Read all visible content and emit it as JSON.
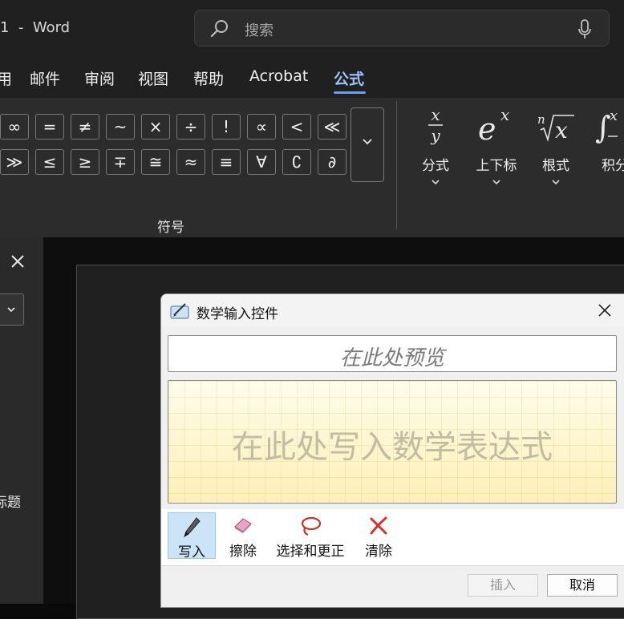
{
  "app": {
    "window_title": "1  -  Word"
  },
  "search": {
    "placeholder": "搜索"
  },
  "menu": [
    {
      "label": "用"
    },
    {
      "label": "邮件"
    },
    {
      "label": "审阅"
    },
    {
      "label": "视图"
    },
    {
      "label": "帮助"
    },
    {
      "label": "Acrobat"
    },
    {
      "label": "公式"
    }
  ],
  "symbols": {
    "row1": [
      "∞",
      "=",
      "≠",
      "~",
      "×",
      "÷",
      "!",
      "∝",
      "<",
      "≪"
    ],
    "row2": [
      "≫",
      "≤",
      "≥",
      "∓",
      "≅",
      "≈",
      "≡",
      "∀",
      "∁",
      "∂"
    ],
    "group_label": "符号"
  },
  "structures": [
    {
      "label": "分式",
      "icon": "fraction-icon"
    },
    {
      "label": "上下标",
      "icon": "script-icon"
    },
    {
      "label": "根式",
      "icon": "radical-icon"
    },
    {
      "label": "积分",
      "icon": "integral-icon"
    }
  ],
  "left_pane": {
    "text": "标题"
  },
  "dialog": {
    "title": "数学输入控件",
    "preview_placeholder": "在此处预览",
    "write_placeholder": "在此处写入数学表达式",
    "tools": [
      {
        "label": "写入",
        "icon": "pen-icon"
      },
      {
        "label": "擦除",
        "icon": "eraser-icon"
      },
      {
        "label": "选择和更正",
        "icon": "lasso-icon"
      },
      {
        "label": "清除",
        "icon": "clear-icon"
      }
    ],
    "insert_label": "插入",
    "cancel_label": "取消"
  },
  "colors": {
    "accent": "#9ec3ff",
    "ribbon_bg": "#2c2c2c",
    "writepad_bg": "#fdf3c6",
    "tool_active": "#cce4f7"
  }
}
